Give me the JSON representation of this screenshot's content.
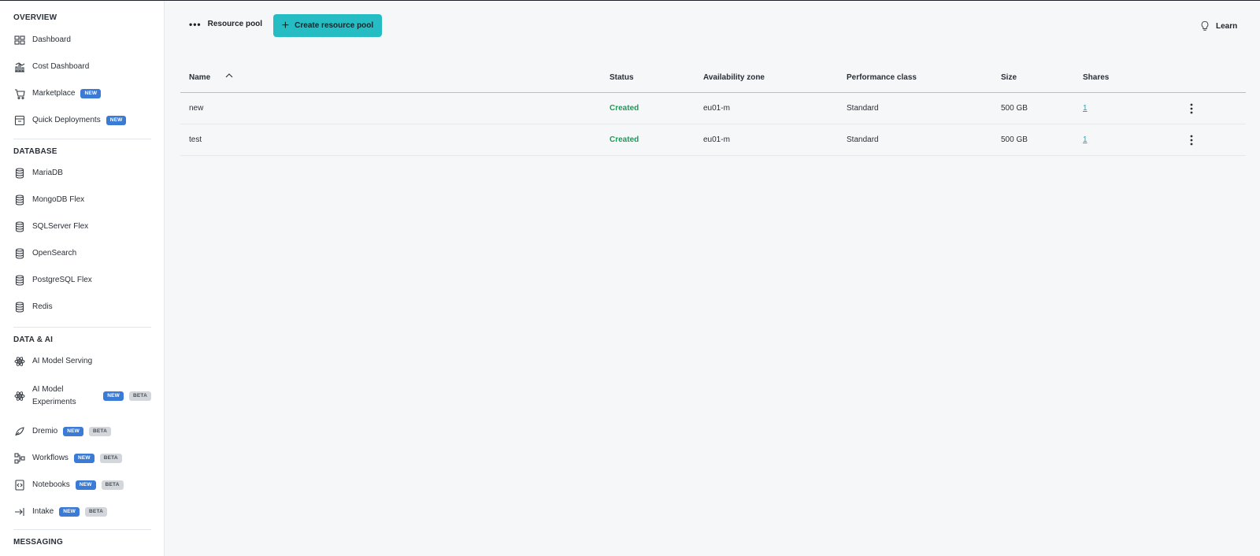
{
  "sidebar": {
    "sections": {
      "overview": "OVERVIEW",
      "database": "DATABASE",
      "data_ai": "DATA & AI",
      "messaging": "MESSAGING"
    },
    "items": {
      "dashboard": "Dashboard",
      "cost_dashboard": "Cost Dashboard",
      "marketplace": "Marketplace",
      "quick_deployments": "Quick Deployments",
      "mariadb": "MariaDB",
      "mongodb": "MongoDB Flex",
      "sqlserver": "SQLServer Flex",
      "opensearch": "OpenSearch",
      "postgresql": "PostgreSQL Flex",
      "redis": "Redis",
      "ai_serving": "AI Model Serving",
      "ai_experiments": "AI Model Experiments",
      "dremio": "Dremio",
      "workflows": "Workflows",
      "notebooks": "Notebooks",
      "intake": "Intake"
    },
    "badges": {
      "new": "NEW",
      "beta": "BETA"
    }
  },
  "toolbar": {
    "title": "Resource pool",
    "dots": "•••",
    "create_label": "Create resource pool",
    "learn_label": "Learn"
  },
  "table": {
    "columns": {
      "name": "Name",
      "status": "Status",
      "zone": "Availability zone",
      "perf": "Performance class",
      "size": "Size",
      "shares": "Shares"
    },
    "rows": [
      {
        "name": "new",
        "status": "Created",
        "zone": "eu01-m",
        "perf": "Standard",
        "size": "500 GB",
        "shares": "1"
      },
      {
        "name": "test",
        "status": "Created",
        "zone": "eu01-m",
        "perf": "Standard",
        "size": "500 GB",
        "shares": "1"
      }
    ]
  },
  "colors": {
    "accent": "#25bcc4",
    "status_created": "#1a9b57",
    "badge_new": "#3b7bd6",
    "badge_beta": "#d3d6da"
  }
}
